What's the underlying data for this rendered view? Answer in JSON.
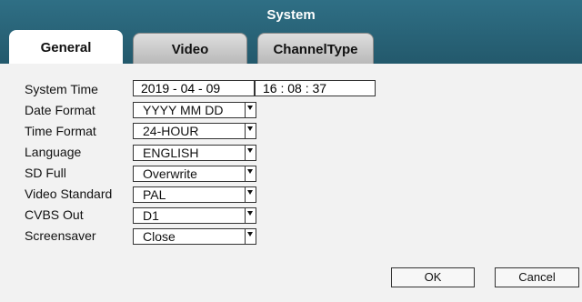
{
  "window": {
    "title": "System"
  },
  "tabs": [
    {
      "label": "General"
    },
    {
      "label": "Video"
    },
    {
      "label": "ChannelType"
    }
  ],
  "form": {
    "system_time": {
      "label": "System Time",
      "date": "2019 - 04 - 09",
      "time": "16 : 08 : 37"
    },
    "date_format": {
      "label": "Date Format",
      "value": "YYYY MM DD"
    },
    "time_format": {
      "label": "Time Format",
      "value": "24-HOUR"
    },
    "language": {
      "label": "Language",
      "value": "ENGLISH"
    },
    "sd_full": {
      "label": "SD Full",
      "value": "Overwrite"
    },
    "video_standard": {
      "label": "Video Standard",
      "value": "PAL"
    },
    "cvbs_out": {
      "label": "CVBS Out",
      "value": "D1"
    },
    "screensaver": {
      "label": "Screensaver",
      "value": "Close"
    }
  },
  "buttons": {
    "ok": "OK",
    "cancel": "Cancel"
  },
  "colors": {
    "titlebar": "#2a6579",
    "panel": "#f2f2f2"
  }
}
